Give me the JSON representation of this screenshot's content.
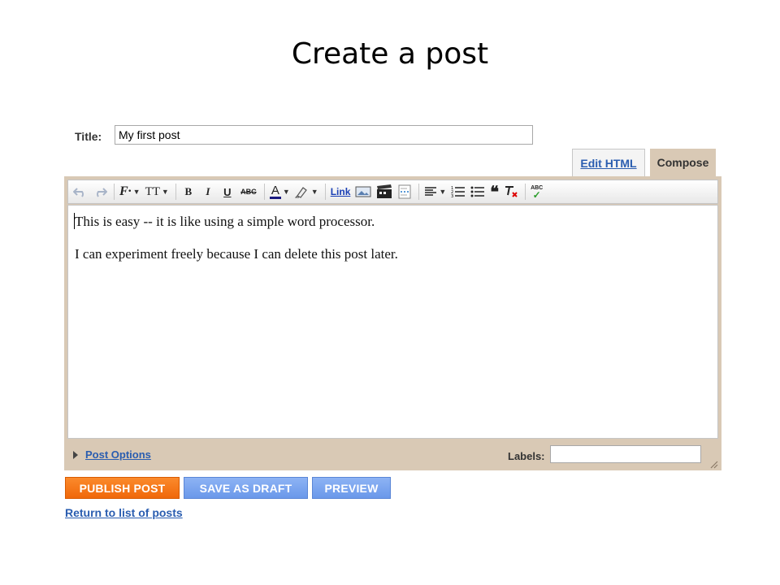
{
  "slide": {
    "title": "Create a post"
  },
  "post": {
    "title_label": "Title:",
    "title_value": "My first post"
  },
  "tabs": {
    "edit_html": "Edit HTML",
    "compose": "Compose"
  },
  "toolbar": {
    "font_glyph": "F·",
    "font_size_glyph": "TT",
    "bold_label": "B",
    "italic_label": "I",
    "underline_label": "U",
    "strike_label": "ABC",
    "text_color_glyph": "A",
    "link_label": "Link",
    "spellcheck_label": "ABC"
  },
  "editor": {
    "lines": [
      "This is easy -- it is like using a simple word processor.",
      "I can experiment freely because I can delete this post later."
    ]
  },
  "footer": {
    "post_options": "Post Options",
    "labels_label": "Labels:",
    "labels_value": ""
  },
  "actions": {
    "publish": "PUBLISH POST",
    "save_draft": "SAVE AS DRAFT",
    "preview": "PREVIEW",
    "return_link": "Return to list of posts"
  },
  "colors": {
    "publish_button": "#f57a1c",
    "secondary_button": "#7ba5ef",
    "editor_frame": "#d9c9b5",
    "link": "#2a5db0"
  }
}
